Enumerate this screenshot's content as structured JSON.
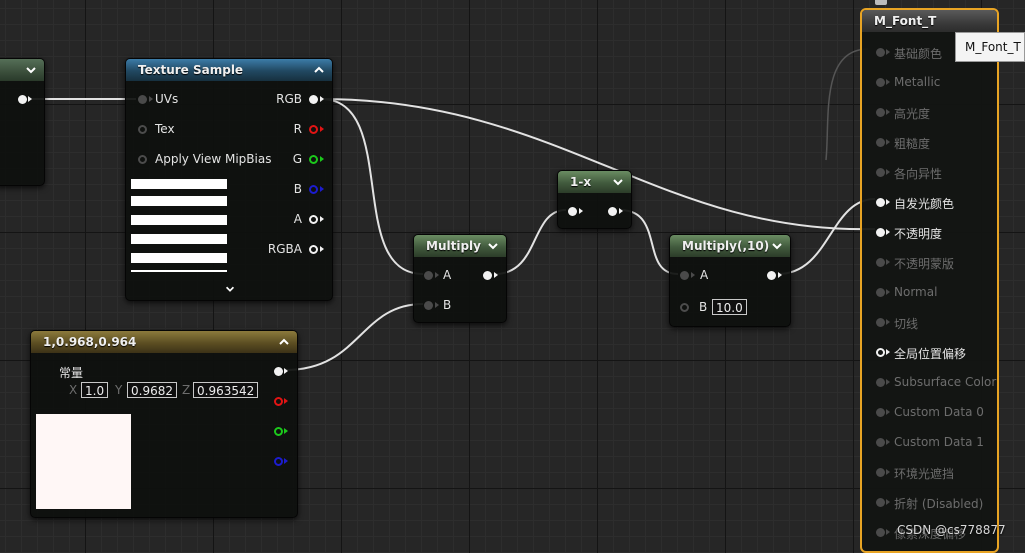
{
  "colors": {
    "canvas": "#262626",
    "texture_header": "#2f6b93",
    "math_header": "#5a7a52",
    "constant_header": "#7a6a30",
    "selection_outline": "#e8a424",
    "wire": "#e0e0e0"
  },
  "texture_sample": {
    "title": "Texture Sample",
    "inputs": [
      "UVs",
      "Tex",
      "Apply View MipBias"
    ],
    "outputs": [
      "RGB",
      "R",
      "G",
      "B",
      "A",
      "RGBA"
    ]
  },
  "multiply1": {
    "title": "Multiply",
    "a": "A",
    "b": "B"
  },
  "oneminus": {
    "title": "1-x"
  },
  "multiply2": {
    "title": "Multiply(,10)",
    "a": "A",
    "b": "B",
    "b_value": "10.0"
  },
  "constant3": {
    "title": "1,0.968,0.964",
    "label": "常量",
    "x_label": "X",
    "x_value": "1.0",
    "y_label": "Y",
    "y_value": "0.9682",
    "z_label": "Z",
    "z_value": "0.963542",
    "preview_color": "#fff7f6"
  },
  "material": {
    "title": "M_Font_T",
    "tooltip": "M_Font_T",
    "pins": [
      {
        "label": "基础颜色",
        "active": false
      },
      {
        "label": "Metallic",
        "active": false
      },
      {
        "label": "高光度",
        "active": false
      },
      {
        "label": "粗糙度",
        "active": false
      },
      {
        "label": "各向异性",
        "active": false
      },
      {
        "label": "自发光颜色",
        "active": true
      },
      {
        "label": "不透明度",
        "active": true
      },
      {
        "label": "不透明蒙版",
        "active": false
      },
      {
        "label": "Normal",
        "active": false
      },
      {
        "label": "切线",
        "active": false
      },
      {
        "label": "全局位置偏移",
        "active": true
      },
      {
        "label": "Subsurface Color",
        "active": false
      },
      {
        "label": "Custom Data 0",
        "active": false
      },
      {
        "label": "Custom Data 1",
        "active": false
      },
      {
        "label": "环境光遮挡",
        "active": false
      },
      {
        "label": "折射 (Disabled)",
        "active": false
      },
      {
        "label": "像素深度偏移",
        "active": false
      }
    ]
  },
  "watermark": "CSDN @cs778877"
}
